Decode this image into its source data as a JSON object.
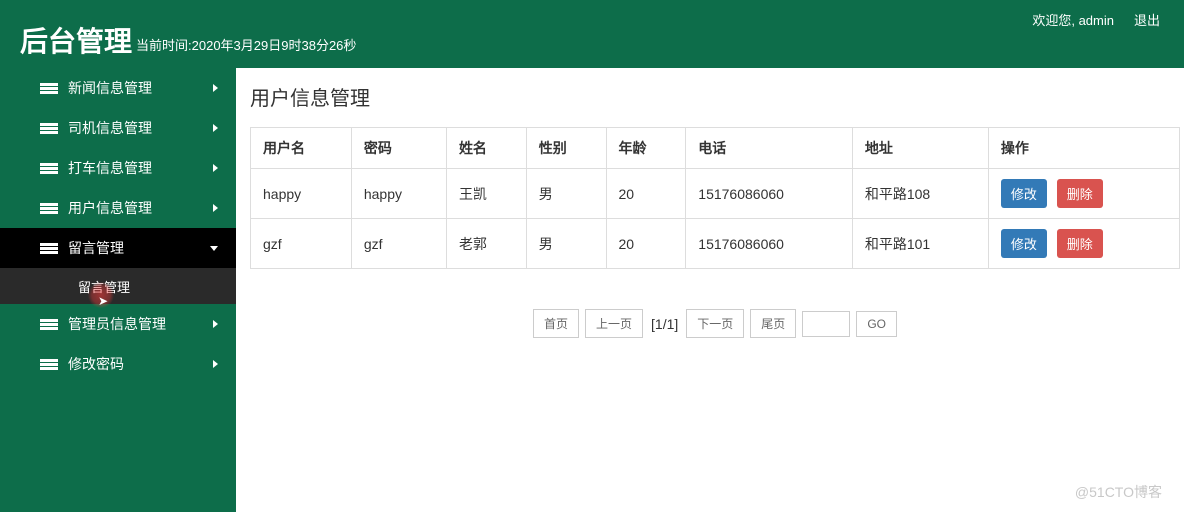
{
  "header": {
    "title": "后台管理",
    "time_prefix": "当前时间:",
    "time_value": "2020年3月29日9时38分26秒",
    "welcome": "欢迎您, admin",
    "logout": "退出"
  },
  "sidebar": {
    "items": [
      {
        "label": "新闻信息管理",
        "expanded": false
      },
      {
        "label": "司机信息管理",
        "expanded": false
      },
      {
        "label": "打车信息管理",
        "expanded": false
      },
      {
        "label": "用户信息管理",
        "expanded": false
      },
      {
        "label": "留言管理",
        "expanded": true,
        "children": [
          {
            "label": "留言管理"
          }
        ]
      },
      {
        "label": "管理员信息管理",
        "expanded": false
      },
      {
        "label": "修改密码",
        "expanded": false
      }
    ]
  },
  "main": {
    "title": "用户信息管理",
    "columns": [
      "用户名",
      "密码",
      "姓名",
      "性别",
      "年龄",
      "电话",
      "地址",
      "操作"
    ],
    "rows": [
      {
        "username": "happy",
        "password": "happy",
        "name": "王凯",
        "gender": "男",
        "age": "20",
        "phone": "15176086060",
        "address": "和平路108"
      },
      {
        "username": "gzf",
        "password": "gzf",
        "name": "老郭",
        "gender": "男",
        "age": "20",
        "phone": "15176086060",
        "address": "和平路101"
      }
    ],
    "actions": {
      "edit": "修改",
      "delete": "删除"
    }
  },
  "pagination": {
    "first": "首页",
    "prev": "上一页",
    "info": "[1/1]",
    "next": "下一页",
    "last": "尾页",
    "go": "GO"
  },
  "watermark": "@51CTO博客"
}
